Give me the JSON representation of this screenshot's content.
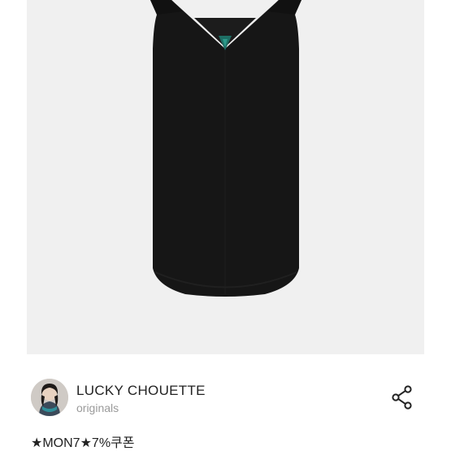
{
  "product": {
    "image_icon": "dress-photo"
  },
  "seller": {
    "name": "LUCKY CHOUETTE",
    "subtitle": "originals",
    "avatar_icon": "avatar-photo"
  },
  "actions": {
    "share_icon": "share-icon"
  },
  "listing": {
    "title": "★MON7★7%쿠폰"
  },
  "colors": {
    "image_background": "#f0f0f0",
    "dress": "#161616",
    "text_primary": "#222222",
    "text_secondary": "#9a9a9a"
  }
}
